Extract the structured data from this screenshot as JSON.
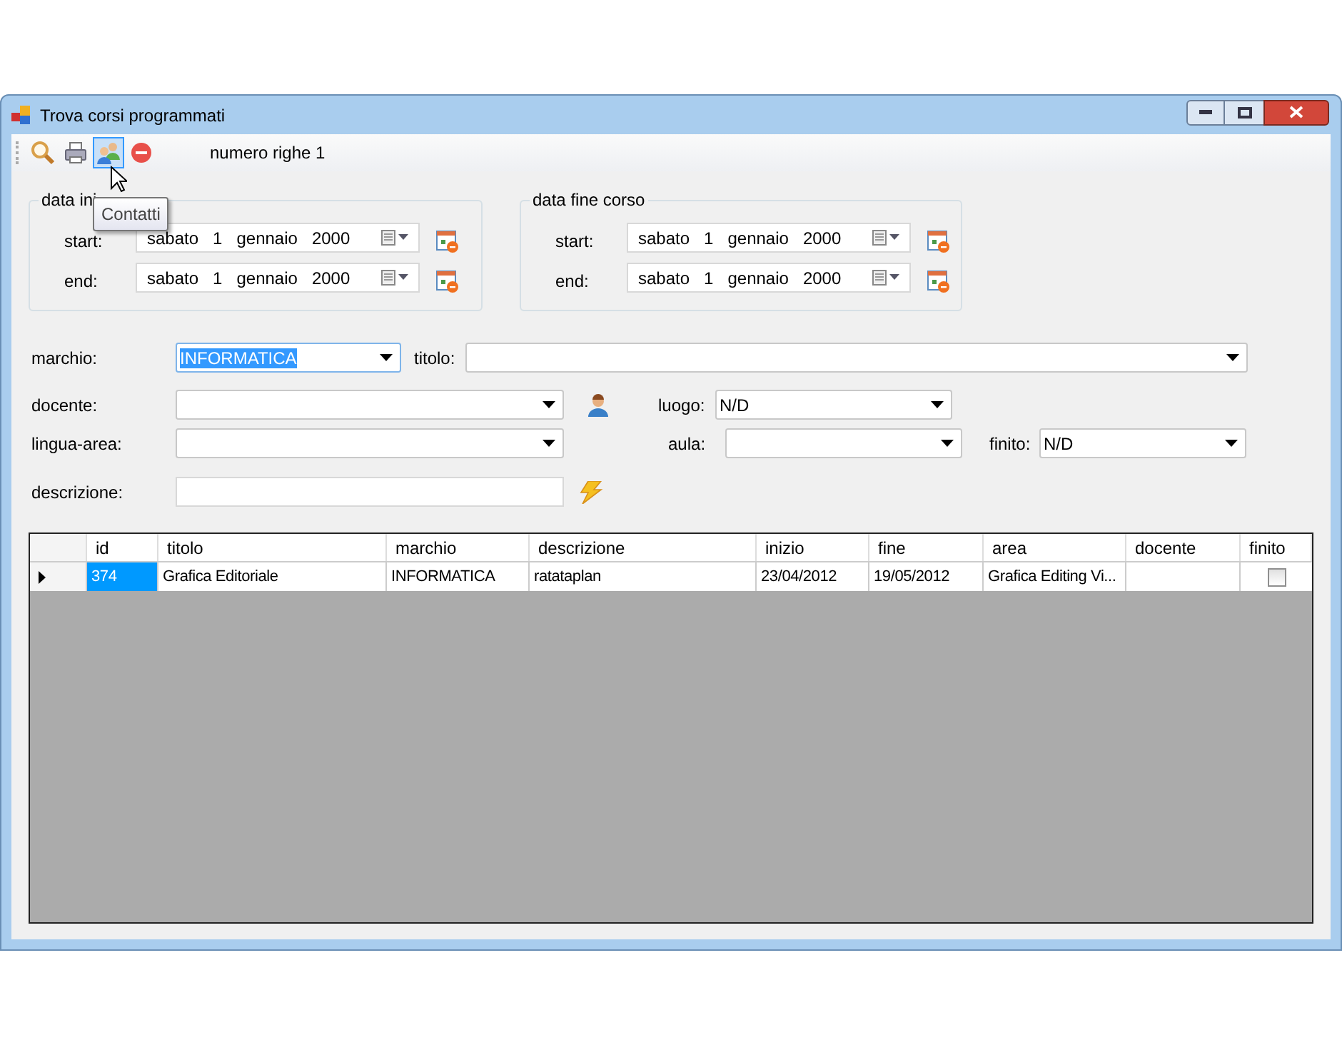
{
  "window": {
    "title": "Trova corsi programmati"
  },
  "toolbar": {
    "buttons": [
      {
        "kind": "search",
        "selected": false
      },
      {
        "kind": "print",
        "selected": false
      },
      {
        "kind": "contacts",
        "selected": true
      },
      {
        "kind": "stop",
        "selected": false
      }
    ],
    "row_count": "numero righe 1",
    "tooltip": "Contatti"
  },
  "date_groups": [
    {
      "title": "data ini",
      "rows": [
        {
          "label": "start:",
          "value": [
            "sabato",
            "1",
            "gennaio",
            "2000"
          ]
        },
        {
          "label": "end:",
          "value": [
            "sabato",
            "1",
            "gennaio",
            "2000"
          ]
        }
      ]
    },
    {
      "title": "data fine corso",
      "rows": [
        {
          "label": "start:",
          "value": [
            "sabato",
            "1",
            "gennaio",
            "2000"
          ]
        },
        {
          "label": "end:",
          "value": [
            "sabato",
            "1",
            "gennaio",
            "2000"
          ]
        }
      ]
    }
  ],
  "filters": {
    "marchio": {
      "label": "marchio:",
      "value": "INFORMATICA"
    },
    "titolo": {
      "label": "titolo:"
    },
    "docente": {
      "label": "docente:"
    },
    "luogo": {
      "label": "luogo:",
      "value": "N/D"
    },
    "lingua_area": {
      "label": "lingua-area:"
    },
    "aula": {
      "label": "aula:"
    },
    "finito": {
      "label": "finito:",
      "value": "N/D"
    },
    "descrizione": {
      "label": "descrizione:"
    }
  },
  "table": {
    "columns": [
      "id",
      "titolo",
      "marchio",
      "descrizione",
      "inizio",
      "fine",
      "area",
      "docente",
      "finito"
    ],
    "rows": [
      {
        "selected": true,
        "cells": [
          "374",
          "Grafica Editoriale",
          "INFORMATICA",
          "ratataplan",
          "23/04/2012",
          "19/05/2012",
          "Grafica Editing Vi..."
        ],
        "finito": false
      }
    ]
  }
}
